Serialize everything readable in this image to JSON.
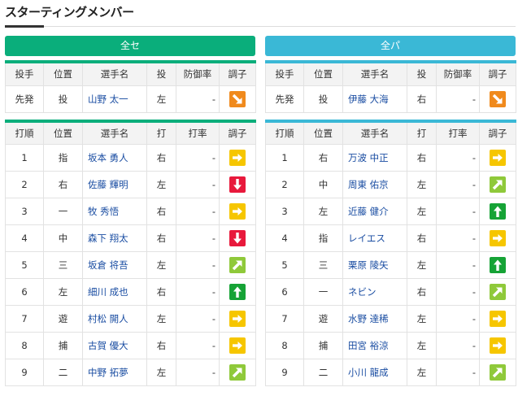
{
  "title": "スターティングメンバー",
  "leagues": [
    {
      "key": "central",
      "name": "全セ",
      "pitcher_headers": [
        "投手",
        "位置",
        "選手名",
        "投",
        "防御率",
        "調子"
      ],
      "pitcher": {
        "role": "先発",
        "pos": "投",
        "name": "山野 太一",
        "hand": "左",
        "era": "-",
        "cond": "down-right-icon"
      },
      "lineup_headers": [
        "打順",
        "位置",
        "選手名",
        "打",
        "打率",
        "調子"
      ],
      "lineup": [
        {
          "order": "1",
          "pos": "指",
          "name": "坂本 勇人",
          "hand": "右",
          "avg": "-",
          "cond": "right-arrow-icon"
        },
        {
          "order": "2",
          "pos": "右",
          "name": "佐藤 輝明",
          "hand": "左",
          "avg": "-",
          "cond": "down-arrow-icon"
        },
        {
          "order": "3",
          "pos": "一",
          "name": "牧 秀悟",
          "hand": "右",
          "avg": "-",
          "cond": "right-arrow-icon"
        },
        {
          "order": "4",
          "pos": "中",
          "name": "森下 翔太",
          "hand": "右",
          "avg": "-",
          "cond": "down-arrow-icon"
        },
        {
          "order": "5",
          "pos": "三",
          "name": "坂倉 将吾",
          "hand": "左",
          "avg": "-",
          "cond": "up-right-arrow-icon"
        },
        {
          "order": "6",
          "pos": "左",
          "name": "細川 成也",
          "hand": "右",
          "avg": "-",
          "cond": "up-arrow-icon"
        },
        {
          "order": "7",
          "pos": "遊",
          "name": "村松 開人",
          "hand": "左",
          "avg": "-",
          "cond": "right-arrow-icon"
        },
        {
          "order": "8",
          "pos": "捕",
          "name": "古賀 優大",
          "hand": "右",
          "avg": "-",
          "cond": "right-arrow-icon"
        },
        {
          "order": "9",
          "pos": "二",
          "name": "中野 拓夢",
          "hand": "左",
          "avg": "-",
          "cond": "up-right-arrow-icon"
        }
      ]
    },
    {
      "key": "pacific",
      "name": "全パ",
      "pitcher_headers": [
        "投手",
        "位置",
        "選手名",
        "投",
        "防御率",
        "調子"
      ],
      "pitcher": {
        "role": "先発",
        "pos": "投",
        "name": "伊藤 大海",
        "hand": "右",
        "era": "-",
        "cond": "down-right-icon"
      },
      "lineup_headers": [
        "打順",
        "位置",
        "選手名",
        "打",
        "打率",
        "調子"
      ],
      "lineup": [
        {
          "order": "1",
          "pos": "右",
          "name": "万波 中正",
          "hand": "右",
          "avg": "-",
          "cond": "right-arrow-icon"
        },
        {
          "order": "2",
          "pos": "中",
          "name": "周東 佑京",
          "hand": "左",
          "avg": "-",
          "cond": "up-right-arrow-icon"
        },
        {
          "order": "3",
          "pos": "左",
          "name": "近藤 健介",
          "hand": "左",
          "avg": "-",
          "cond": "up-arrow-icon"
        },
        {
          "order": "4",
          "pos": "指",
          "name": "レイエス",
          "hand": "右",
          "avg": "-",
          "cond": "right-arrow-icon"
        },
        {
          "order": "5",
          "pos": "三",
          "name": "栗原 陵矢",
          "hand": "左",
          "avg": "-",
          "cond": "up-arrow-icon"
        },
        {
          "order": "6",
          "pos": "一",
          "name": "ネビン",
          "hand": "右",
          "avg": "-",
          "cond": "up-right-arrow-icon"
        },
        {
          "order": "7",
          "pos": "遊",
          "name": "水野 達稀",
          "hand": "左",
          "avg": "-",
          "cond": "right-arrow-icon"
        },
        {
          "order": "8",
          "pos": "捕",
          "name": "田宮 裕涼",
          "hand": "左",
          "avg": "-",
          "cond": "right-arrow-icon"
        },
        {
          "order": "9",
          "pos": "二",
          "name": "小川 龍成",
          "hand": "左",
          "avg": "-",
          "cond": "up-right-arrow-icon"
        }
      ]
    }
  ],
  "colors": {
    "central": "#0aae7b",
    "pacific": "#3ab8d6",
    "up": "#16a336",
    "up_right": "#8fc93a",
    "right": "#f6c600",
    "down_right": "#f08a1d",
    "down": "#e8193c",
    "player_link": "#1a4da2"
  }
}
